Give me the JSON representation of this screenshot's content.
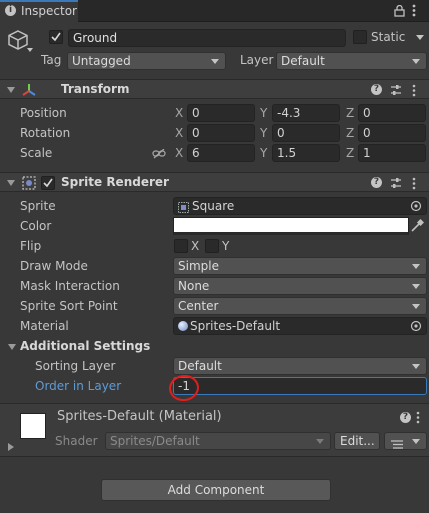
{
  "tab": {
    "title": "Inspector"
  },
  "gameobject": {
    "name": "Ground",
    "static_label": "Static",
    "tag_label": "Tag",
    "tag_value": "Untagged",
    "layer_label": "Layer",
    "layer_value": "Default"
  },
  "transform": {
    "title": "Transform",
    "rows": [
      {
        "label": "Position",
        "x": "0",
        "y": "-4.3",
        "z": "0"
      },
      {
        "label": "Rotation",
        "x": "0",
        "y": "0",
        "z": "0"
      },
      {
        "label": "Scale",
        "x": "6",
        "y": "1.5",
        "z": "1"
      }
    ],
    "axes": {
      "x": "X",
      "y": "Y",
      "z": "Z"
    }
  },
  "sprite_renderer": {
    "title": "Sprite Renderer",
    "sprite_label": "Sprite",
    "sprite_value": "Square",
    "color_label": "Color",
    "flip_label": "Flip",
    "flip_x": "X",
    "flip_y": "Y",
    "draw_mode_label": "Draw Mode",
    "draw_mode_value": "Simple",
    "mask_label": "Mask Interaction",
    "mask_value": "None",
    "sort_point_label": "Sprite Sort Point",
    "sort_point_value": "Center",
    "material_label": "Material",
    "material_value": "Sprites-Default",
    "additional_label": "Additional Settings",
    "sorting_layer_label": "Sorting Layer",
    "sorting_layer_value": "Default",
    "order_label": "Order in Layer",
    "order_value": "-1"
  },
  "material": {
    "title": "Sprites-Default (Material)",
    "shader_label": "Shader",
    "shader_value": "Sprites/Default",
    "edit_label": "Edit..."
  },
  "add_component": {
    "label": "Add Component"
  },
  "colors": {
    "accent": "#3a79bb",
    "annotation": "#e01e1e",
    "label_highlight": "#5f9bd6"
  }
}
